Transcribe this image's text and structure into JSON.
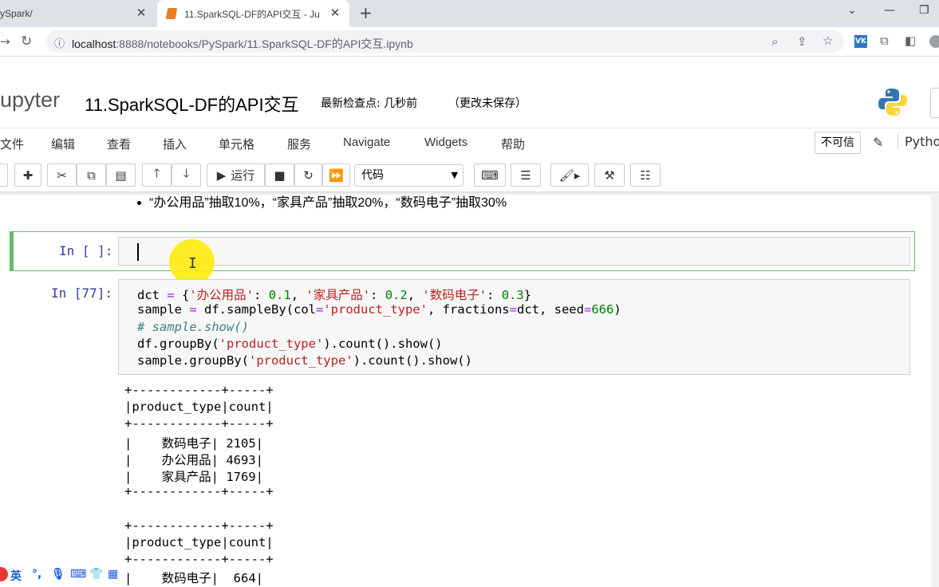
{
  "browser": {
    "tabs": [
      {
        "title": "ySpark/"
      },
      {
        "title": "11.SparkSQL-DF的API交互 - Ju"
      }
    ],
    "url_host": "localhost",
    "url_path": ":8888/notebooks/PySpark/11.SparkSQL-DF的API交互.ipynb"
  },
  "jupyter": {
    "logo_text": "upyter",
    "notebook_title": "11.SparkSQL-DF的API交互",
    "checkpoint": "最新检查点: 几秒前",
    "unsaved": "（更改未保存）",
    "menu": [
      "文件",
      "编辑",
      "查看",
      "插入",
      "单元格",
      "服务",
      "Navigate",
      "Widgets",
      "帮助"
    ],
    "trusted": "不可信",
    "kernel": "Python",
    "run_label": "运行",
    "cell_type": "代码"
  },
  "notebook": {
    "bullet_text": "“办公用品”抽取10%，“家具产品”抽取20%，“数码电子”抽取30%",
    "cell1_prompt": "In [ ]:",
    "cell2_prompt": "In [77]:",
    "code_lines": [
      "dct = {'办公用品': 0.1, '家具产品': 0.2, '数码电子': 0.3}",
      "sample = df.sampleBy(col='product_type', fractions=dct, seed=666)",
      "# sample.show()",
      "df.groupBy('product_type').count().show()",
      "sample.groupBy('product_type').count().show()"
    ],
    "output_lines": [
      "+------------+-----+",
      "|product_type|count|",
      "+------------+-----+",
      "|    数码电子| 2105|",
      "|    办公用品| 4693|",
      "|    家具产品| 1769|",
      "+------------+-----+",
      "",
      "+------------+-----+",
      "|product_type|count|",
      "+------------+-----+",
      "|    数码电子|  664|"
    ]
  },
  "ime": {
    "lang": "英"
  }
}
